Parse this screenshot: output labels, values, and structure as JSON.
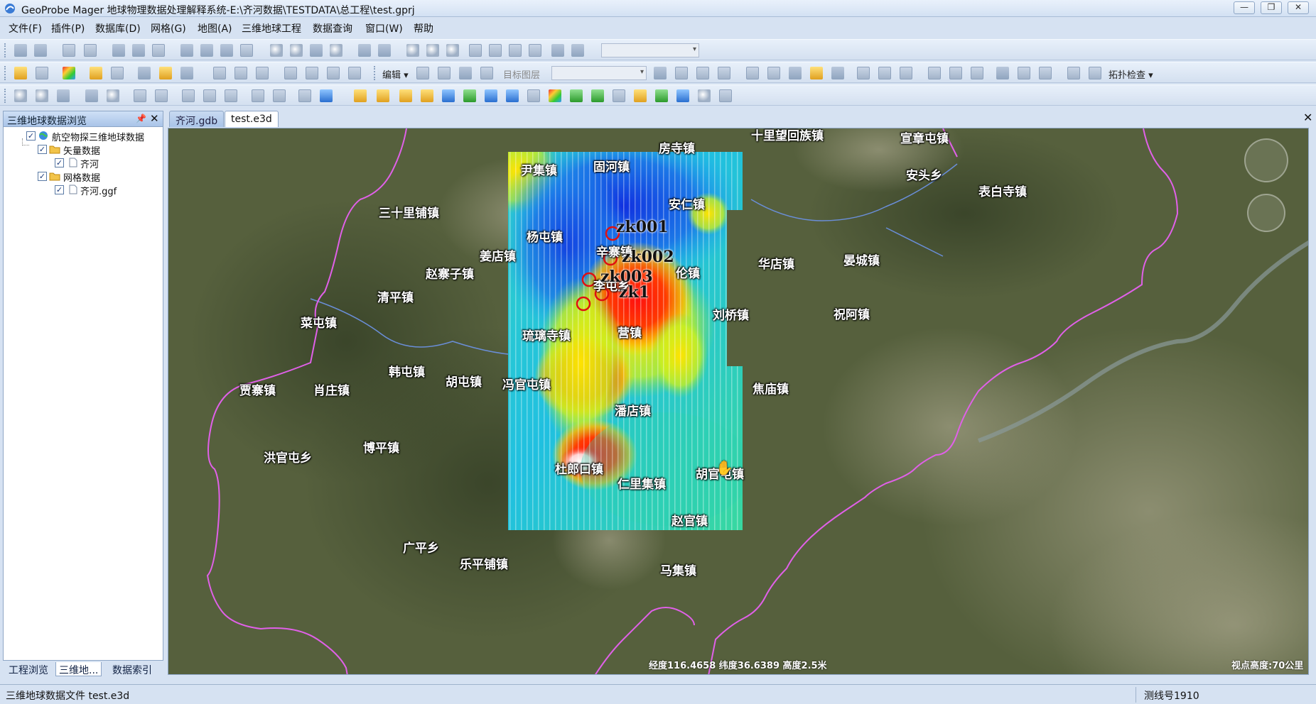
{
  "window": {
    "title": "GeoProbe Mager 地球物理数据处理解释系统-E:\\齐河数据\\TESTDATA\\总工程\\test.gprj",
    "minimize": "—",
    "restore": "❐",
    "close": "✕"
  },
  "menu": [
    "文件(F)",
    "插件(P)",
    "数据库(D)",
    "网格(G)",
    "地图(A)",
    "三维地球工程",
    "数据查询",
    "窗口(W)",
    "帮助"
  ],
  "toolbar2": {
    "edit_label": "编辑 ▾",
    "target_layer_label": "目标图层",
    "topology_label": "拓扑检查 ▾"
  },
  "left_panel": {
    "title": "三维地球数据浏览",
    "pin": "📌",
    "close": "✕",
    "tree": [
      {
        "label": "航空物探三维地球数据",
        "checked": "✓"
      },
      {
        "label": "矢量数据",
        "checked": "✓"
      },
      {
        "label": "齐河",
        "checked": "✓"
      },
      {
        "label": "网格数据",
        "checked": "✓"
      },
      {
        "label": "齐河.ggf",
        "checked": "✓"
      }
    ],
    "tabs": [
      "工程浏览",
      "三维地...",
      "数据索引"
    ]
  },
  "doc_tabs": [
    "齐河.gdb",
    "test.e3d"
  ],
  "doc_close": "✕",
  "map": {
    "places": [
      "十里望回族镇",
      "宣章屯镇",
      "房寺镇",
      "尹集镇",
      "固河镇",
      "安头乡",
      "表白寺镇",
      "三十里铺镇",
      "安仁镇",
      "杨屯镇",
      "辛寨镇",
      "姜店镇",
      "华店镇",
      "晏城镇",
      "赵寨子镇",
      "伦镇",
      "李屯乡",
      "清平镇",
      "刘桥镇",
      "祝阿镇",
      "菜屯镇",
      "琉璃寺镇",
      "营镇",
      "韩屯镇",
      "胡屯镇",
      "冯官屯镇",
      "焦庙镇",
      "贾寨镇",
      "肖庄镇",
      "潘店镇",
      "博平镇",
      "洪官屯乡",
      "杜郎口镇",
      "仁里集镇",
      "胡官屯镇",
      "赵官镇",
      "广平乡",
      "乐平铺镇",
      "马集镇"
    ],
    "points": [
      "zk001",
      "zk002",
      "zk003",
      "zk1"
    ],
    "coords": "经度116.4658  纬度36.6389  高度2.5米",
    "eye_alt": "视点高度:70公里",
    "cursor": "✋"
  },
  "status": {
    "left": "三维地球数据文件 test.e3d",
    "right": "测线号1910"
  }
}
